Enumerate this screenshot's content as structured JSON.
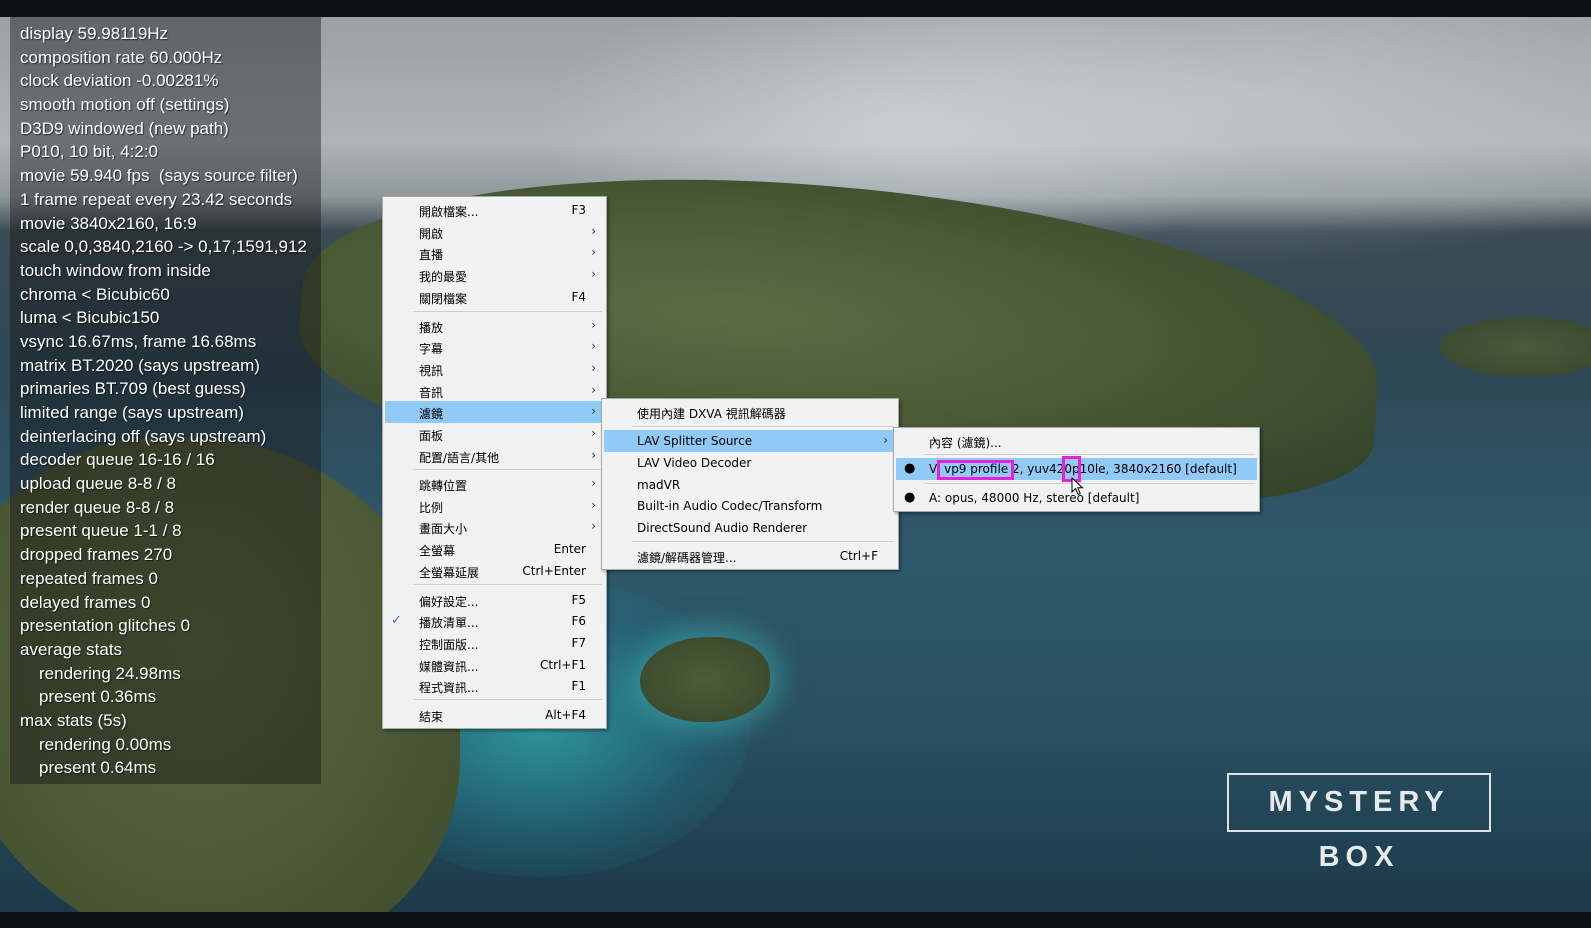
{
  "osd": {
    "lines": [
      "display 59.98119Hz",
      "composition rate 60.000Hz",
      "clock deviation -0.00281%",
      "smooth motion off (settings)",
      "D3D9 windowed (new path)",
      "P010, 10 bit, 4:2:0",
      "movie 59.940 fps  (says source filter)",
      "1 frame repeat every 23.42 seconds",
      "movie 3840x2160, 16:9",
      "scale 0,0,3840,2160 -> 0,17,1591,912",
      "touch window from inside",
      "chroma < Bicubic60",
      "luma < Bicubic150",
      "vsync 16.67ms, frame 16.68ms",
      "matrix BT.2020 (says upstream)",
      "primaries BT.709 (best guess)",
      "limited range (says upstream)",
      "deinterlacing off (says upstream)",
      "decoder queue 16-16 / 16",
      "upload queue 8-8 / 8",
      "render queue 8-8 / 8",
      "present queue 1-1 / 8",
      "dropped frames 270",
      "repeated frames 0",
      "delayed frames 0",
      "presentation glitches 0",
      "average stats",
      "rendering 24.98ms",
      "present 0.36ms",
      "max stats (5s)",
      "rendering 0.00ms",
      "present 0.64ms"
    ]
  },
  "watermark": "MYSTERY BOX",
  "context_menu": {
    "items": [
      {
        "label": "開啟檔案...",
        "accel": "F3"
      },
      {
        "label": "開啟",
        "accel": "",
        "submenu": true
      },
      {
        "label": "直播",
        "accel": "",
        "submenu": true
      },
      {
        "label": "我的最愛",
        "accel": "",
        "submenu": true
      },
      {
        "label": "關閉檔案",
        "accel": "F4"
      },
      {
        "label": "播放",
        "accel": "",
        "submenu": true
      },
      {
        "label": "字幕",
        "accel": "",
        "submenu": true
      },
      {
        "label": "視訊",
        "accel": "",
        "submenu": true
      },
      {
        "label": "音訊",
        "accel": "",
        "submenu": true
      },
      {
        "label": "濾鏡",
        "accel": "",
        "submenu": true,
        "highlighted": true
      },
      {
        "label": "面板",
        "accel": "",
        "submenu": true
      },
      {
        "label": "配置/語言/其他",
        "accel": "",
        "submenu": true
      },
      {
        "label": "跳轉位置",
        "accel": "",
        "submenu": true
      },
      {
        "label": "比例",
        "accel": "",
        "submenu": true
      },
      {
        "label": "畫面大小",
        "accel": "",
        "submenu": true
      },
      {
        "label": "全螢幕",
        "accel": "Enter"
      },
      {
        "label": "全螢幕延展",
        "accel": "Ctrl+Enter"
      },
      {
        "label": "偏好設定...",
        "accel": "F5"
      },
      {
        "label": "播放清單...",
        "accel": "F6",
        "checked": true
      },
      {
        "label": "控制面版...",
        "accel": "F7"
      },
      {
        "label": "媒體資訊...",
        "accel": "Ctrl+F1"
      },
      {
        "label": "程式資訊...",
        "accel": "F1"
      },
      {
        "label": "結束",
        "accel": "Alt+F4"
      }
    ]
  },
  "filters_submenu": {
    "items": [
      {
        "label": "使用內建 DXVA 視訊解碼器",
        "accel": ""
      },
      {
        "label": "LAV Splitter Source",
        "accel": "",
        "submenu": true,
        "highlighted": true
      },
      {
        "label": "LAV Video Decoder",
        "accel": ""
      },
      {
        "label": "madVR",
        "accel": ""
      },
      {
        "label": "Built-in Audio Codec/Transform",
        "accel": ""
      },
      {
        "label": "DirectSound Audio Renderer",
        "accel": ""
      },
      {
        "label": "濾鏡/解碼器管理...",
        "accel": "Ctrl+F"
      }
    ]
  },
  "splitter_submenu": {
    "items": [
      {
        "label": "內容 (濾鏡)...",
        "selected": false
      },
      {
        "label": "V: vp9 profile 2, yuv420p10le, 3840x2160 [default]",
        "selected": true,
        "highlighted": true
      },
      {
        "label": "A: opus, 48000 Hz, stereo [default]",
        "selected": true
      }
    ],
    "bullet": "●"
  },
  "icons": {
    "submenu_arrow": "›",
    "check": "✓",
    "cursor": "arrow-cursor-icon"
  },
  "colors": {
    "menu_bg": "#f2f2f2",
    "menu_highlight": "#91c9f7",
    "annotation": "#e61fe0"
  }
}
